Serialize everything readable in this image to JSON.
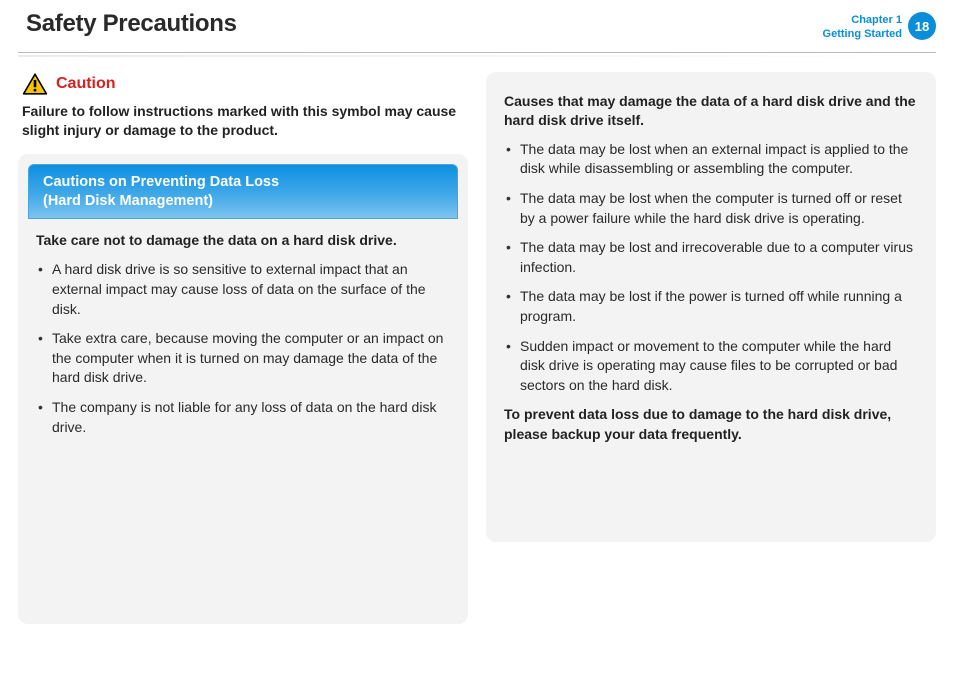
{
  "header": {
    "title": "Safety Precautions",
    "chapter_line1": "Chapter 1",
    "chapter_line2": "Getting Started",
    "page_number": "18"
  },
  "caution": {
    "label": "Caution",
    "lead": "Failure to follow instructions marked with this symbol may cause slight injury or damage to the product."
  },
  "left_panel": {
    "banner_line1": "Cautions on Preventing Data Loss",
    "banner_line2": "(Hard Disk Management)",
    "subhead": "Take care not to damage the data on a hard disk drive.",
    "items": [
      "A hard disk drive is so sensitive to external impact that an external impact may cause loss of data on the surface of the disk.",
      "Take extra care, because moving the computer or an impact on the computer when it is turned on may damage the data of the hard disk drive.",
      "The company is not liable for any loss of data on the hard disk drive."
    ]
  },
  "right_panel": {
    "subhead": "Causes that may damage the data of a hard disk drive and the hard disk drive itself.",
    "items": [
      "The data may be lost when an external impact is applied to the disk while disassembling or assembling the computer.",
      "The data may be lost when the computer is turned off or reset by a power failure while the hard disk drive is operating.",
      "The data may be lost and irrecoverable due to a computer virus infection.",
      "The data may be lost if the power is turned off while running a program.",
      "Sudden impact or movement to the computer while the hard disk drive is operating may cause files to be corrupted or bad sectors on the hard disk."
    ],
    "closing": "To prevent data loss due to damage to the hard disk drive, please backup your data frequently."
  }
}
